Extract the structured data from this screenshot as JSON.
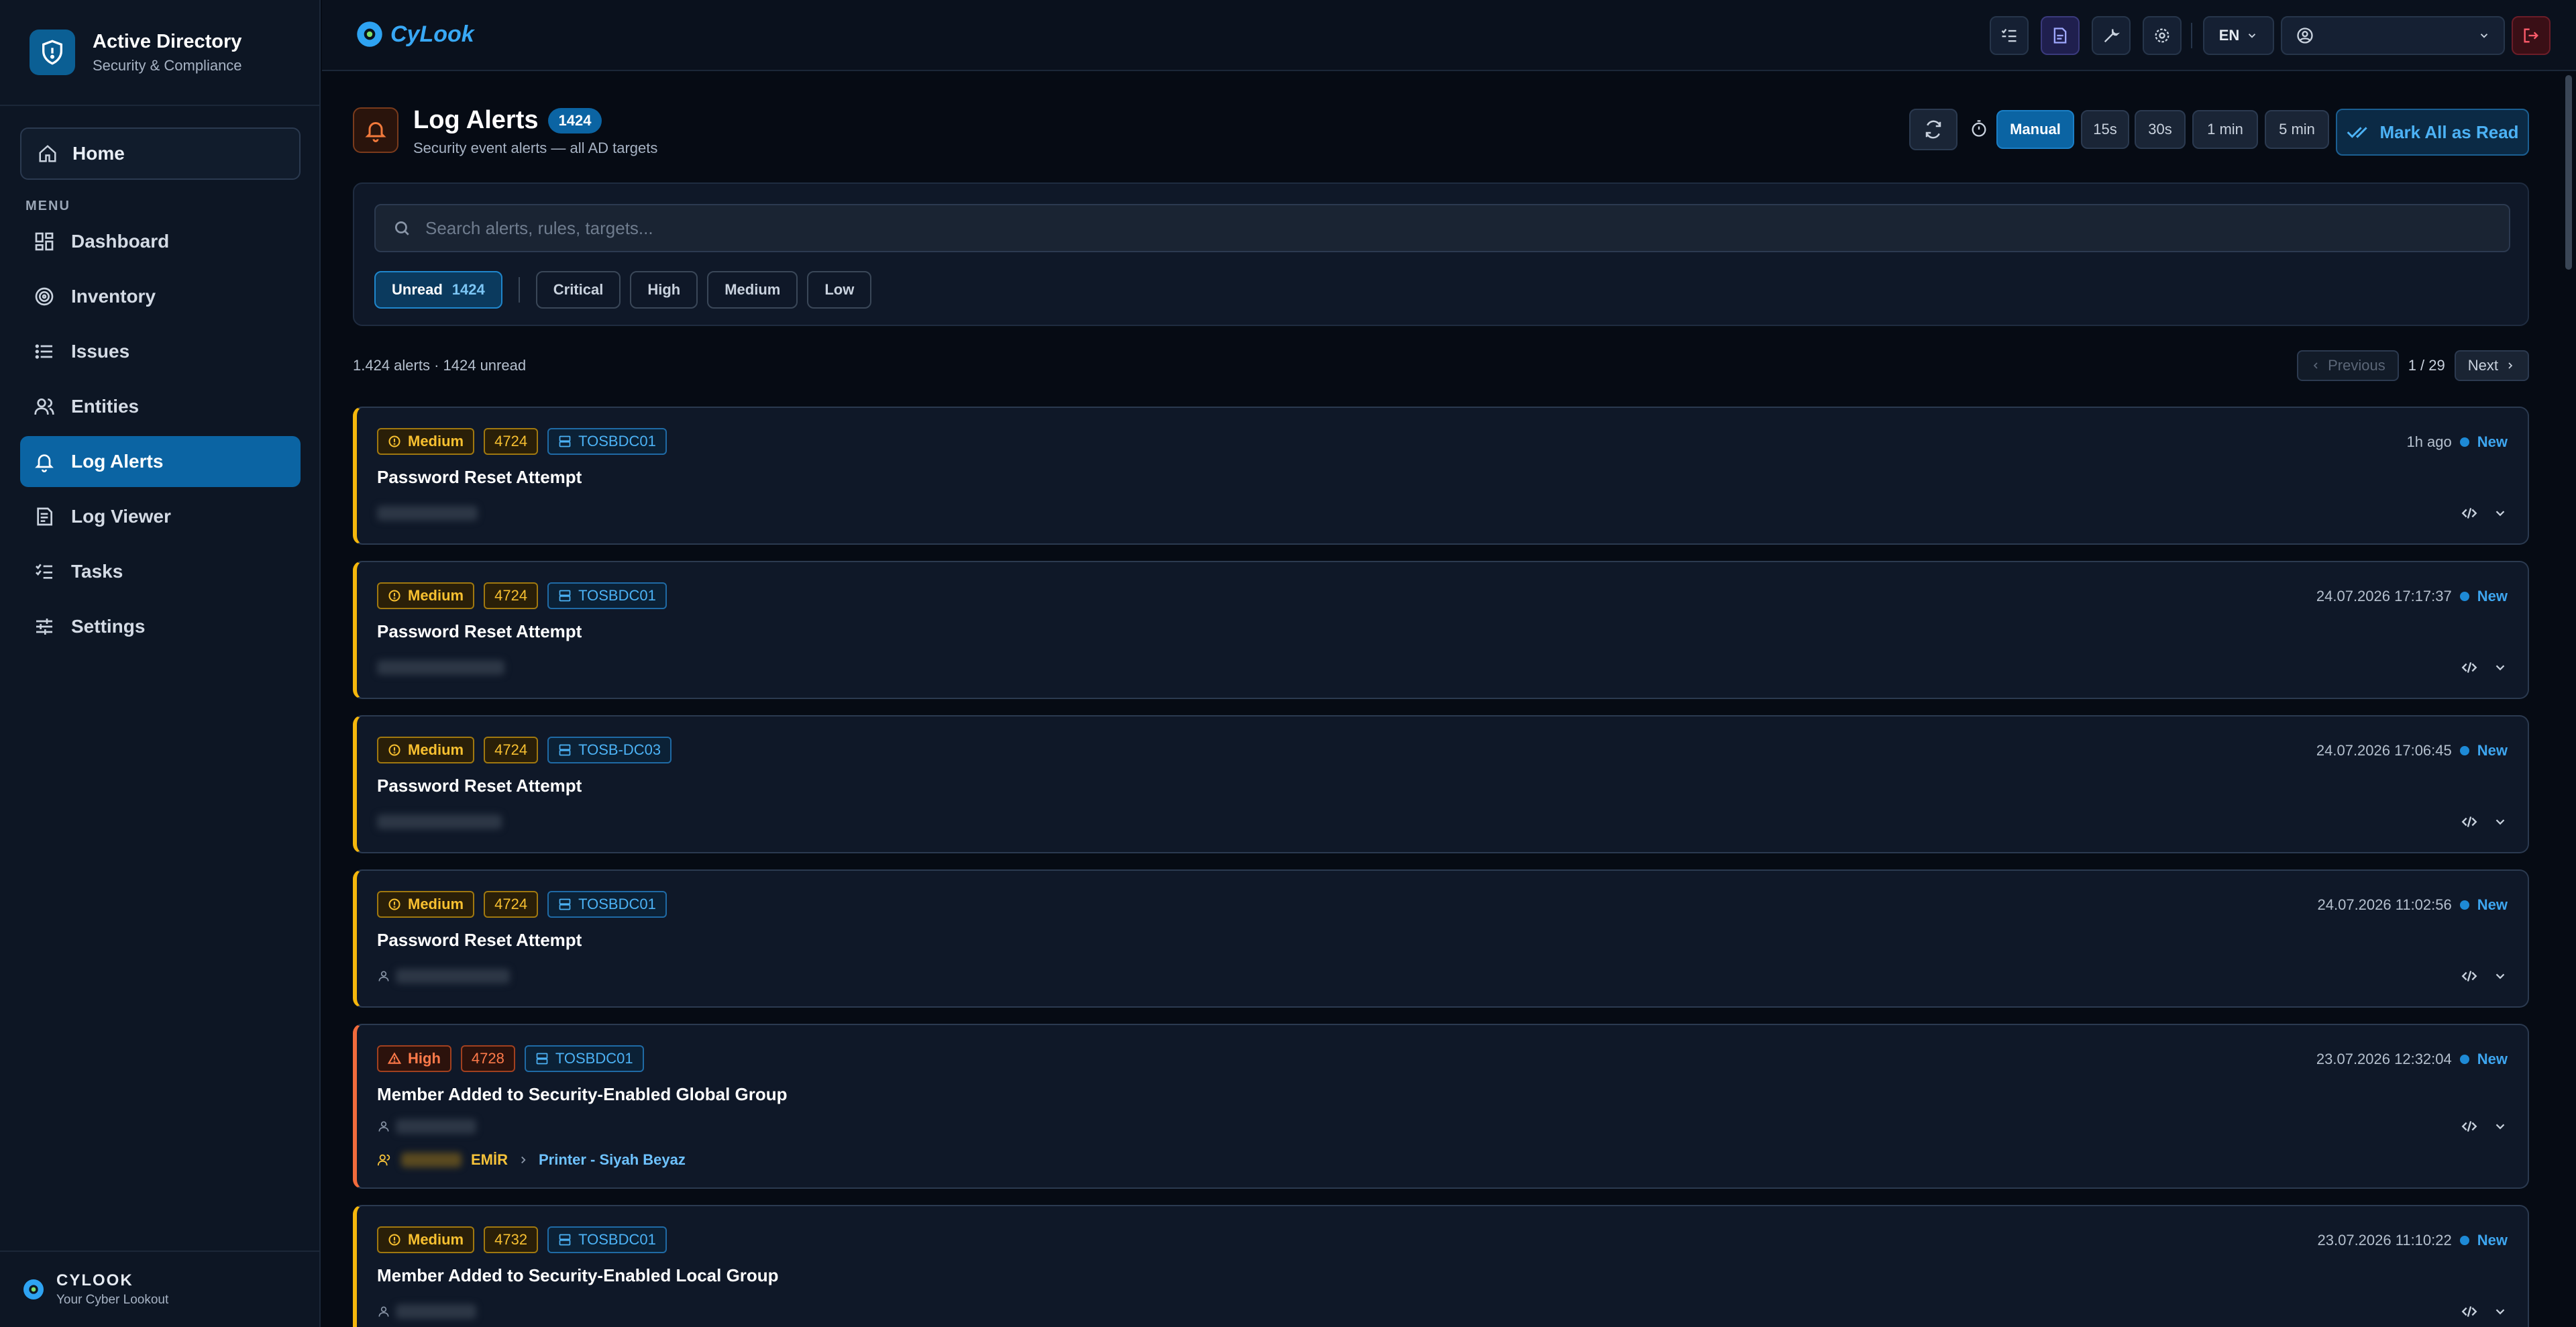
{
  "app": {
    "title": "Active Directory",
    "subtitle": "Security & Compliance",
    "logo_text": "CyLook",
    "footer_title": "CYLOOK",
    "footer_subtitle": "Your Cyber Lookout"
  },
  "sidebar": {
    "home_label": "Home",
    "menu_label": "MENU",
    "items": [
      {
        "label": "Dashboard",
        "icon": "dashboard-icon"
      },
      {
        "label": "Inventory",
        "icon": "target-icon"
      },
      {
        "label": "Issues",
        "icon": "list-icon"
      },
      {
        "label": "Entities",
        "icon": "users-icon"
      },
      {
        "label": "Log Alerts",
        "icon": "bell-icon",
        "active": true
      },
      {
        "label": "Log Viewer",
        "icon": "log-viewer-icon"
      },
      {
        "label": "Tasks",
        "icon": "tasks-icon"
      },
      {
        "label": "Settings",
        "icon": "sliders-icon"
      }
    ]
  },
  "topbar": {
    "language": "EN"
  },
  "page": {
    "title": "Log Alerts",
    "count": "1424",
    "subtitle": "Security event alerts — all AD targets",
    "intervals": [
      "Manual",
      "15s",
      "30s",
      "1 min",
      "5 min"
    ],
    "active_interval": "Manual",
    "mark_all_label": "Mark All as Read"
  },
  "filters": {
    "search_placeholder": "Search alerts, rules, targets...",
    "unread_label": "Unread",
    "unread_count": "1424",
    "severities": [
      "Critical",
      "High",
      "Medium",
      "Low"
    ]
  },
  "summary": {
    "text": "1.424 alerts · 1424 unread",
    "prev_label": "Previous",
    "page_info": "1 / 29",
    "next_label": "Next"
  },
  "alerts": [
    {
      "severity": "Medium",
      "event_id": "4724",
      "host": "TOSBDC01",
      "title": "Password Reset Attempt",
      "time": "1h ago",
      "status": "New"
    },
    {
      "severity": "Medium",
      "event_id": "4724",
      "host": "TOSBDC01",
      "title": "Password Reset Attempt",
      "time": "24.07.2026 17:17:37",
      "status": "New"
    },
    {
      "severity": "Medium",
      "event_id": "4724",
      "host": "TOSB-DC03",
      "title": "Password Reset Attempt",
      "time": "24.07.2026 17:06:45",
      "status": "New"
    },
    {
      "severity": "Medium",
      "event_id": "4724",
      "host": "TOSBDC01",
      "title": "Password Reset Attempt",
      "time": "24.07.2026 11:02:56",
      "status": "New"
    },
    {
      "severity": "High",
      "event_id": "4728",
      "host": "TOSBDC01",
      "title": "Member Added to Security-Enabled Global Group",
      "time": "23.07.2026 12:32:04",
      "status": "New",
      "member_suffix": "EMİR",
      "group": "Printer - Siyah Beyaz"
    },
    {
      "severity": "Medium",
      "event_id": "4732",
      "host": "TOSBDC01",
      "title": "Member Added to Security-Enabled Local Group",
      "time": "23.07.2026 11:10:22",
      "status": "New"
    }
  ],
  "colors": {
    "accent": "#0b64a3",
    "medium": "#f5b70c",
    "high": "#f26b3c",
    "host": "#4cb2f5"
  }
}
